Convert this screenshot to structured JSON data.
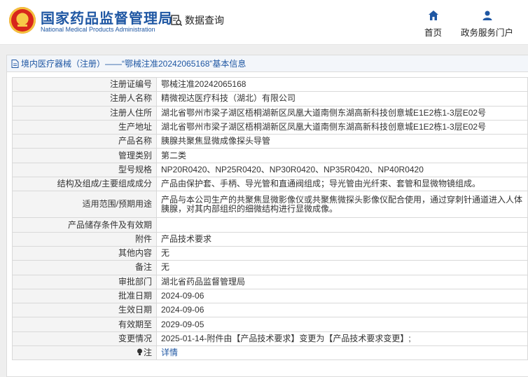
{
  "header": {
    "brand_cn": "国家药品监督管理局",
    "brand_en": "National Medical Products Administration",
    "query_label": "数据查询",
    "nav": [
      {
        "label": "首页",
        "icon": "home-icon"
      },
      {
        "label": "政务服务门户",
        "icon": "user-icon"
      }
    ]
  },
  "breadcrumb": "境内医疗器械（注册）——“鄂械注准20242065168”基本信息",
  "colors": {
    "brand_blue": "#1f57a3",
    "label_bg": "#f4f4f4",
    "border": "#d9d9d9"
  },
  "rows": [
    {
      "label": "注册证编号",
      "value": "鄂械注准20242065168"
    },
    {
      "label": "注册人名称",
      "value": "精微视达医疗科技（湖北）有限公司"
    },
    {
      "label": "注册人住所",
      "value": "湖北省鄂州市梁子湖区梧桐湖新区凤凰大道南侧东湖高新科技创意城E1E2栋1-3层E02号"
    },
    {
      "label": "生产地址",
      "value": "湖北省鄂州市梁子湖区梧桐湖新区凤凰大道南侧东湖高新科技创意城E1E2栋1-3层E02号"
    },
    {
      "label": "产品名称",
      "value": "胰腺共聚焦显微成像探头导管"
    },
    {
      "label": "管理类别",
      "value": "第二类"
    },
    {
      "label": "型号规格",
      "value": "NP20R0420、NP25R0420、NP30R0420、NP35R0420、NP40R0420"
    },
    {
      "label": "结构及组成/主要组成成分",
      "value": "产品由保护套、手柄、导光管和直通阀组成；导光管由光纤束、套管和显微物镜组成。"
    },
    {
      "label": "适用范围/预期用途",
      "value": "产品与本公司生产的共聚焦显微影像仪或共聚焦微探头影像仪配合使用，通过穿刺针通道进入人体胰腺，对其内部组织的细微结构进行显微成像。"
    },
    {
      "label": "产品储存条件及有效期",
      "value": ""
    },
    {
      "label": "附件",
      "value": "产品技术要求"
    },
    {
      "label": "其他内容",
      "value": "无"
    },
    {
      "label": "备注",
      "value": "无"
    },
    {
      "label": "审批部门",
      "value": "湖北省药品监督管理局"
    },
    {
      "label": "批准日期",
      "value": "2024-09-06"
    },
    {
      "label": "生效日期",
      "value": "2024-09-06"
    },
    {
      "label": "有效期至",
      "value": "2029-09-05"
    },
    {
      "label": "变更情况",
      "value": "2025-01-14-附件由【产品技术要求】变更为【产品技术要求变更】;"
    },
    {
      "label": "注",
      "value": "详情"
    }
  ]
}
